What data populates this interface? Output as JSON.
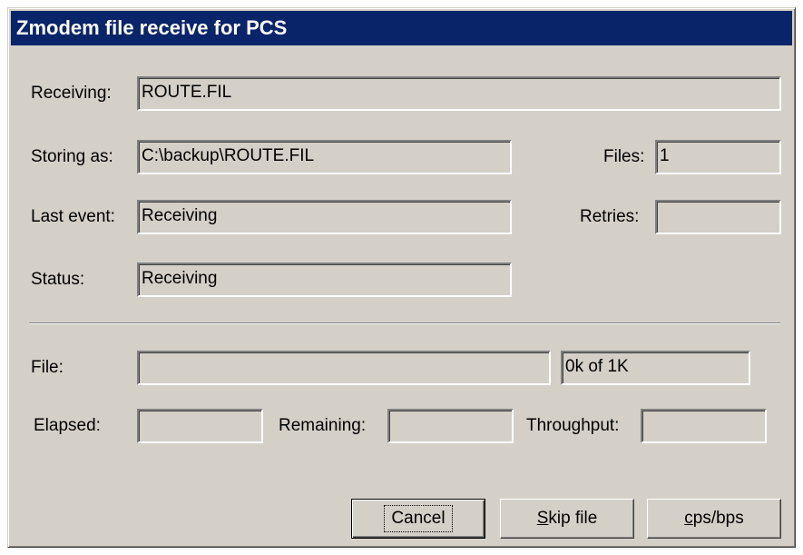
{
  "window": {
    "title": "Zmodem file receive for PCS"
  },
  "receiving": {
    "label": "Receiving:",
    "value": "ROUTE.FIL"
  },
  "storing_as": {
    "label": "Storing as:",
    "value": "C:\\backup\\ROUTE.FIL"
  },
  "files": {
    "label": "Files:",
    "value": "1"
  },
  "last_event": {
    "label": "Last event:",
    "value": "Receiving"
  },
  "retries": {
    "label": "Retries:",
    "value": ""
  },
  "status": {
    "label": "Status:",
    "value": "Receiving"
  },
  "file_progress": {
    "label": "File:",
    "progress": 0,
    "text": "0k of 1K"
  },
  "elapsed": {
    "label": "Elapsed:",
    "value": ""
  },
  "remaining": {
    "label": "Remaining:",
    "value": ""
  },
  "throughput": {
    "label": "Throughput:",
    "value": ""
  },
  "buttons": {
    "cancel": "Cancel",
    "skip_file_mnemonic": "S",
    "skip_file_rest": "kip file",
    "cps_mnemonic": "c",
    "cps_rest": "ps/bps"
  },
  "colors": {
    "titlebar": "#0a246a",
    "face": "#d4d0c8"
  }
}
